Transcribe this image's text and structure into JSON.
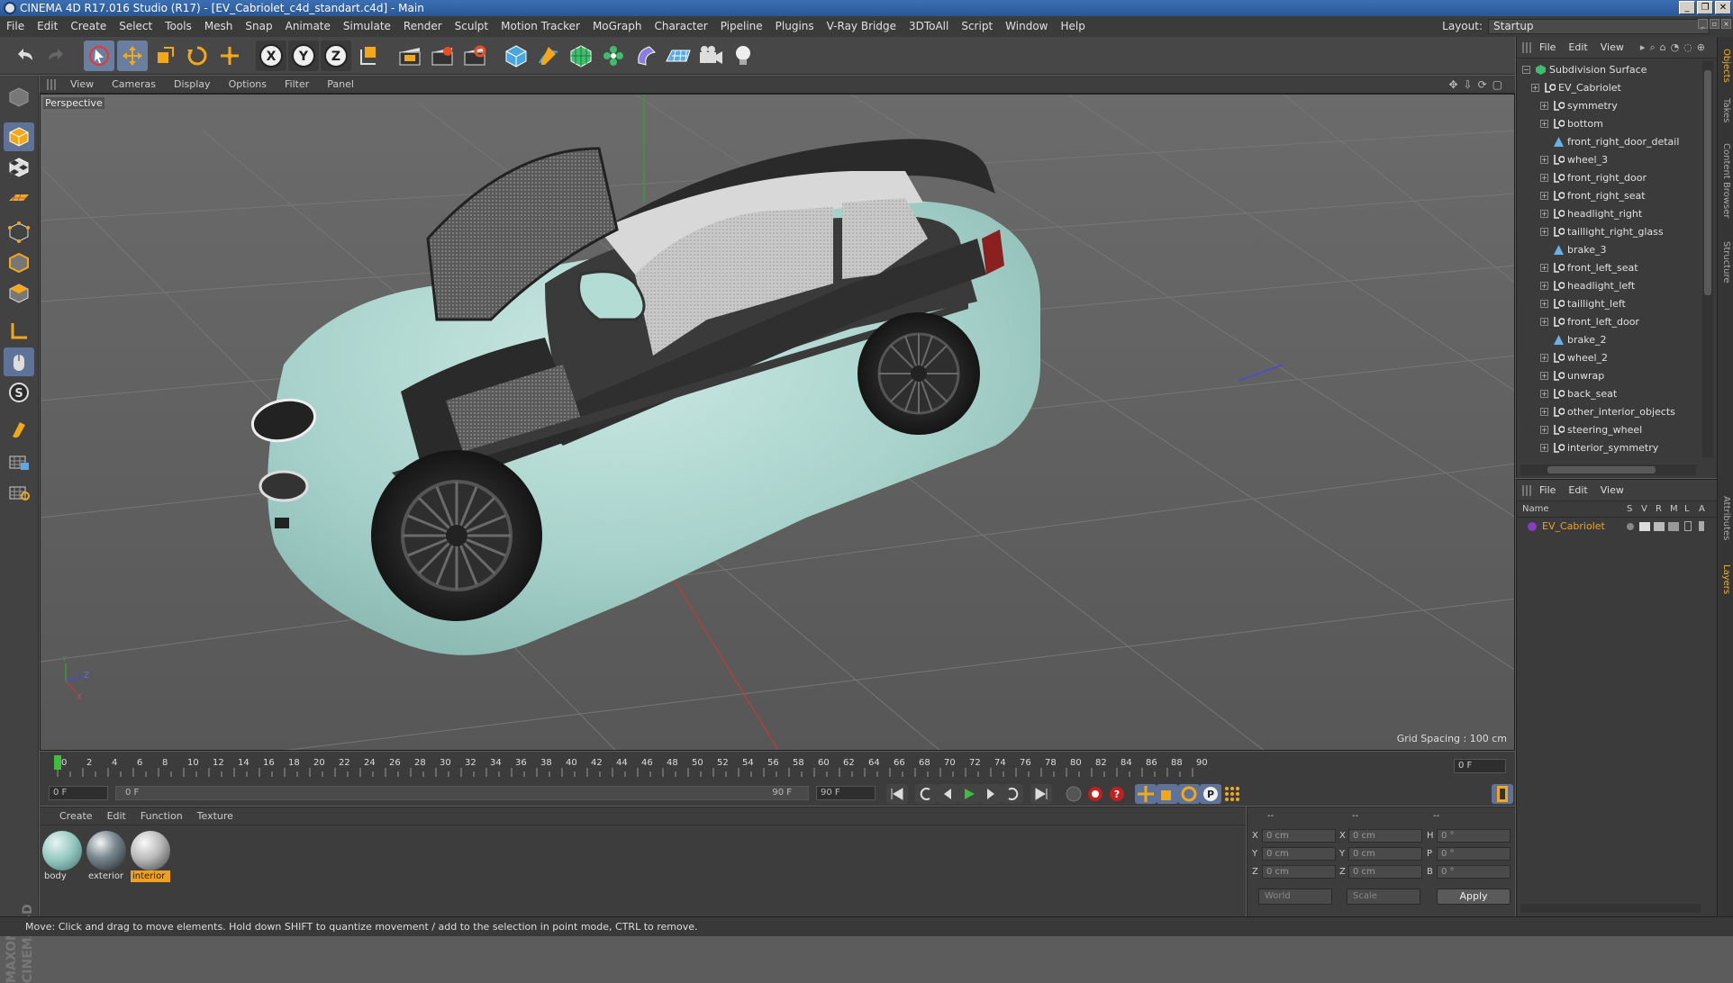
{
  "window": {
    "title": "CINEMA 4D R17.016 Studio (R17) - [EV_Cabriolet_c4d_standart.c4d] - Main",
    "controls": [
      "_",
      "❐",
      "✕"
    ]
  },
  "menubar": {
    "items": [
      "File",
      "Edit",
      "Create",
      "Select",
      "Tools",
      "Mesh",
      "Snap",
      "Animate",
      "Simulate",
      "Render",
      "Sculpt",
      "Motion Tracker",
      "MoGraph",
      "Character",
      "Pipeline",
      "Plugins",
      "V-Ray Bridge",
      "3DToAll",
      "Script",
      "Window",
      "Help"
    ],
    "layout_label": "Layout:",
    "layout_value": "Startup"
  },
  "toolbar": {
    "axis_x": "X",
    "axis_y": "Y",
    "axis_z": "Z"
  },
  "viewport": {
    "menu": [
      "View",
      "Cameras",
      "Display",
      "Options",
      "Filter",
      "Panel"
    ],
    "label": "Perspective",
    "grid_spacing": "Grid Spacing : 100 cm",
    "nav_icons": "✥⇩⟳▢",
    "axis_labels": {
      "x": "X",
      "y": "Y",
      "z": "Z"
    }
  },
  "timeline": {
    "ticks": [
      "0",
      "2",
      "4",
      "6",
      "8",
      "10",
      "12",
      "14",
      "16",
      "18",
      "20",
      "22",
      "24",
      "26",
      "28",
      "30",
      "32",
      "34",
      "36",
      "38",
      "40",
      "42",
      "44",
      "46",
      "48",
      "50",
      "52",
      "54",
      "56",
      "58",
      "60",
      "62",
      "64",
      "66",
      "68",
      "70",
      "72",
      "74",
      "76",
      "78",
      "80",
      "82",
      "84",
      "86",
      "88",
      "90"
    ],
    "current_frame": "0 F"
  },
  "transport": {
    "start_frame": "0 F",
    "range_start": "0 F",
    "range_end": "90 F",
    "end_frame": "90 F"
  },
  "materials": {
    "menu": [
      "Create",
      "Edit",
      "Function",
      "Texture"
    ],
    "items": [
      {
        "name": "body",
        "color": "#8fc4bd"
      },
      {
        "name": "exterior",
        "color": "#7c8a92"
      },
      {
        "name": "interior",
        "color": "#b8b8b8",
        "selected": true
      }
    ]
  },
  "coordinates": {
    "headers": [
      "--",
      "--",
      "--"
    ],
    "rows": [
      {
        "a": "X",
        "av": "0 cm",
        "b": "X",
        "bv": "0 cm",
        "c": "H",
        "cv": "0 °"
      },
      {
        "a": "Y",
        "av": "0 cm",
        "b": "Y",
        "bv": "0 cm",
        "c": "P",
        "cv": "0 °"
      },
      {
        "a": "Z",
        "av": "0 cm",
        "b": "Z",
        "bv": "0 cm",
        "c": "B",
        "cv": "0 °"
      }
    ],
    "world": "World",
    "scale": "Scale",
    "apply": "Apply"
  },
  "object_manager": {
    "menu": [
      "File",
      "Edit",
      "View"
    ],
    "objects": [
      {
        "name": "Subdivision Surface",
        "type": "subdiv",
        "depth": 0
      },
      {
        "name": "EV_Cabriolet",
        "type": "null",
        "depth": 1
      },
      {
        "name": "symmetry",
        "type": "null",
        "depth": 2
      },
      {
        "name": "bottom",
        "type": "null",
        "depth": 2
      },
      {
        "name": "front_right_door_detail",
        "type": "poly",
        "depth": 2
      },
      {
        "name": "wheel_3",
        "type": "null",
        "depth": 2
      },
      {
        "name": "front_right_door",
        "type": "null",
        "depth": 2
      },
      {
        "name": "front_right_seat",
        "type": "null",
        "depth": 2
      },
      {
        "name": "headlight_right",
        "type": "null",
        "depth": 2
      },
      {
        "name": "taillight_right_glass",
        "type": "null",
        "depth": 2
      },
      {
        "name": "brake_3",
        "type": "poly",
        "depth": 2
      },
      {
        "name": "front_left_seat",
        "type": "null",
        "depth": 2
      },
      {
        "name": "headlight_left",
        "type": "null",
        "depth": 2
      },
      {
        "name": "taillight_left",
        "type": "null",
        "depth": 2
      },
      {
        "name": "front_left_door",
        "type": "null",
        "depth": 2
      },
      {
        "name": "brake_2",
        "type": "poly",
        "depth": 2
      },
      {
        "name": "wheel_2",
        "type": "null",
        "depth": 2
      },
      {
        "name": "unwrap",
        "type": "null",
        "depth": 2
      },
      {
        "name": "back_seat",
        "type": "null",
        "depth": 2
      },
      {
        "name": "other_interior_objects",
        "type": "null",
        "depth": 2
      },
      {
        "name": "steering_wheel",
        "type": "null",
        "depth": 2
      },
      {
        "name": "interior_symmetry",
        "type": "null",
        "depth": 2
      }
    ]
  },
  "layer_manager": {
    "menu": [
      "File",
      "Edit",
      "View"
    ],
    "columns": [
      "Name",
      "S",
      "V",
      "R",
      "M",
      "L",
      "A"
    ],
    "layer": {
      "name": "EV_Cabriolet",
      "color": "#f0a020"
    }
  },
  "side_tabs": [
    "Objects",
    "Takes",
    "Content Browser",
    "Structure",
    "Attributes",
    "Layers"
  ],
  "statusbar": {
    "text": "Move: Click and drag to move elements. Hold down SHIFT to quantize movement / add to the selection in point mode, CTRL to remove."
  },
  "colors": {
    "car_body": "#a9d3cc",
    "accent": "#f0a020",
    "selection": "#6a7ea0"
  }
}
